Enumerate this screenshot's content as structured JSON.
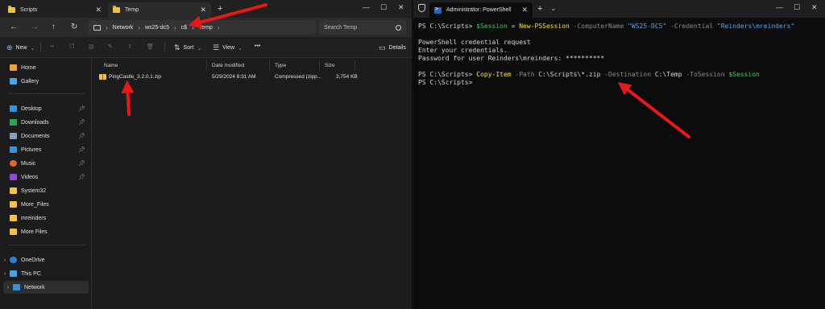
{
  "colors": {
    "accent": "#e81818",
    "terminal_bg": "#0c0c0c",
    "explorer_bg": "#1c1c1c",
    "ps_var": "#44c86e",
    "ps_cmd": "#f2e24c",
    "ps_string": "#58a6e8",
    "ps_param": "#8a8a8a"
  },
  "explorer": {
    "tabs": [
      {
        "label": "Scripts",
        "icon": "folder-icon"
      },
      {
        "label": "Temp",
        "icon": "folder-icon"
      }
    ],
    "address": {
      "segments": [
        "Network",
        "ws25-dc5",
        "c$",
        "Temp"
      ]
    },
    "search_placeholder": "Search Temp",
    "toolbar": {
      "new_label": "New",
      "sort_label": "Sort",
      "view_label": "View",
      "details_label": "Details"
    },
    "sidebar": {
      "top": [
        {
          "label": "Home",
          "icon": "home-icon"
        },
        {
          "label": "Gallery",
          "icon": "gallery-icon"
        }
      ],
      "quick": [
        {
          "label": "Desktop",
          "icon": "desktop-icon"
        },
        {
          "label": "Downloads",
          "icon": "download-icon"
        },
        {
          "label": "Documents",
          "icon": "document-icon"
        },
        {
          "label": "Pictures",
          "icon": "pictures-icon"
        },
        {
          "label": "Music",
          "icon": "music-icon"
        },
        {
          "label": "Videos",
          "icon": "videos-icon"
        },
        {
          "label": "System32",
          "icon": "folder-icon"
        },
        {
          "label": "More_Files",
          "icon": "folder-icon"
        },
        {
          "label": "mreinders",
          "icon": "folder-icon"
        },
        {
          "label": "More Files",
          "icon": "folder-icon"
        }
      ],
      "bottom": [
        {
          "label": "OneDrive",
          "icon": "cloud-icon"
        },
        {
          "label": "This PC",
          "icon": "pc-icon"
        },
        {
          "label": "Network",
          "icon": "network-icon"
        }
      ]
    },
    "columns": [
      "Name",
      "Date modified",
      "Type",
      "Size"
    ],
    "files": [
      {
        "name": "PingCastle_3.2.0.1.zip",
        "date": "5/29/2024 8:31 AM",
        "type": "Compressed (zipp...",
        "size": "3,754 KB"
      }
    ]
  },
  "terminal": {
    "tab_title": "Administrator: PowerShell",
    "lines": {
      "l1_prompt": "PS C:\\Scripts> ",
      "l1_var": "$Session",
      "l1_eq": " = ",
      "l1_cmd": "New-PSSession",
      "l1_p1": " -ComputerName ",
      "l1_s1": "\"WS25-DC5\"",
      "l1_p2": " -Credential ",
      "l1_s2": "\"Reinders\\mreinders\"",
      "l2": "PowerShell credential request",
      "l3": "Enter your credentials.",
      "l4": "Password for user Reinders\\mreinders: **********",
      "l5_prompt": "PS C:\\Scripts> ",
      "l5_cmd": "Copy-Item",
      "l5_p1": " -Path ",
      "l5_v1": "C:\\Scripts\\*.zip",
      "l5_p2": " -Destination ",
      "l5_v2": "C:\\Temp",
      "l5_p3": " -ToSession ",
      "l5_var": "$Session",
      "l6": "PS C:\\Scripts>"
    }
  }
}
